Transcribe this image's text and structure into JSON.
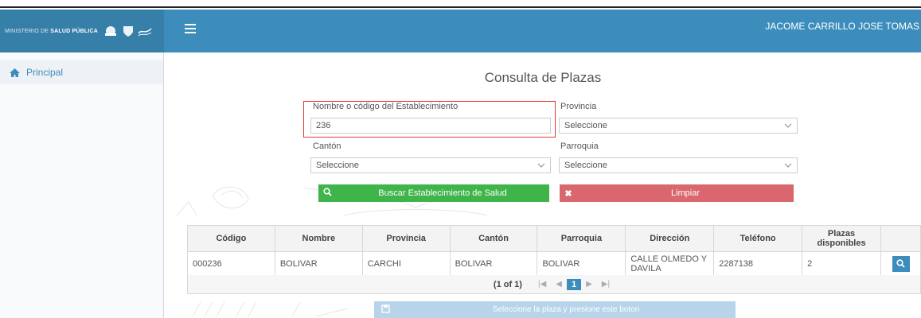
{
  "header": {
    "logo_text_prefix": "MINISTERIO DE ",
    "logo_text_bold": "SALUD PÚBLICA",
    "user_name": "JACOME CARRILLO JOSE TOMAS"
  },
  "sidebar": {
    "items": [
      {
        "label": "Principal",
        "icon": "home-icon"
      }
    ]
  },
  "page": {
    "title": "Consulta de Plazas"
  },
  "form": {
    "establecimiento_label": "Nombre o código del Establecimiento",
    "establecimiento_value": "236",
    "provincia_label": "Provincia",
    "provincia_value": "Seleccione",
    "canton_label": "Cantón",
    "canton_value": "Seleccione",
    "parroquia_label": "Parroquia",
    "parroquia_value": "Seleccione",
    "search_button": "Buscar Establecimiento de Salud",
    "clear_button": "Limpiar"
  },
  "table": {
    "headers": [
      "Código",
      "Nombre",
      "Provincia",
      "Cantón",
      "Parroquia",
      "Dirección",
      "Teléfono",
      "Plazas disponibles",
      ""
    ],
    "rows": [
      [
        "000236",
        "BOLIVAR",
        "CARCHI",
        "BOLIVAR",
        "BOLIVAR",
        "CALLE OLMEDO Y DAVILA",
        "2287138",
        "2"
      ]
    ]
  },
  "pagination": {
    "count": "(1 of 1)",
    "current_page": "1"
  },
  "bottom_button": {
    "label": "Seleccione la plaza y presione este boton"
  },
  "colors": {
    "topbar": "#3c8dbc",
    "search_button": "#3fb44a",
    "clear_button": "#d9676d",
    "highlight": "#e53935"
  }
}
